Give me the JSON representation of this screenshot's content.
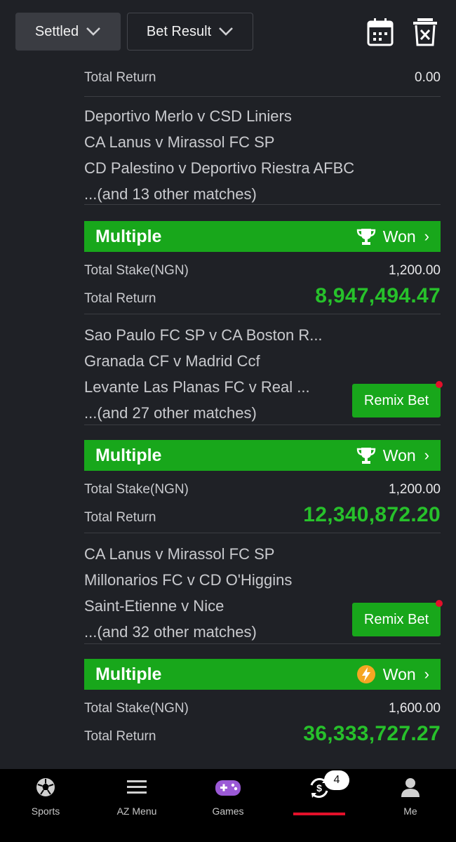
{
  "filters": {
    "status_label": "Settled",
    "result_label": "Bet Result"
  },
  "top_bet": {
    "total_return_label": "Total Return",
    "total_return_value": "0.00",
    "matches": [
      "Deportivo Merlo v CSD Liniers",
      "CA Lanus v Mirassol FC SP",
      "CD Palestino v Deportivo Riestra AFBC"
    ],
    "more": "...(and 13 other matches)"
  },
  "bets": [
    {
      "type": "Multiple",
      "status": "Won",
      "icon": "trophy-icon",
      "stake_label": "Total Stake(NGN)",
      "stake_value": "1,200.00",
      "return_label": "Total Return",
      "return_value": "8,947,494.47",
      "matches": [
        "Sao Paulo FC SP v CA Boston R...",
        "Granada CF v Madrid Ccf",
        "Levante Las Planas FC v Real ..."
      ],
      "more": "...(and 27 other matches)",
      "remix_label": "Remix Bet"
    },
    {
      "type": "Multiple",
      "status": "Won",
      "icon": "trophy-icon",
      "stake_label": "Total Stake(NGN)",
      "stake_value": "1,200.00",
      "return_label": "Total Return",
      "return_value": "12,340,872.20",
      "matches": [
        "CA Lanus v Mirassol FC SP",
        "Millonarios FC v CD O'Higgins",
        "Saint-Etienne v Nice"
      ],
      "more": "...(and 32 other matches)",
      "remix_label": "Remix Bet"
    },
    {
      "type": "Multiple",
      "status": "Won",
      "icon": "lightning-icon",
      "stake_label": "Total Stake(NGN)",
      "stake_value": "1,600.00",
      "return_label": "Total Return",
      "return_value": "36,333,727.27"
    }
  ],
  "nav": {
    "sports": "Sports",
    "az_menu": "AZ Menu",
    "games": "Games",
    "bets_badge": "4",
    "me": "Me"
  },
  "colors": {
    "accent_green": "#18a71b",
    "return_green": "#27c12b",
    "active_red": "#e3102a",
    "background": "#1f2126"
  }
}
